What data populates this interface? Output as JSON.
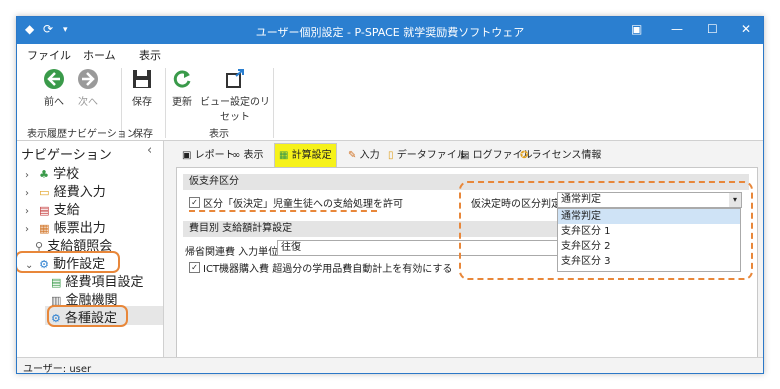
{
  "window": {
    "title": "ユーザー個別設定 - P-SPACE 就学奨励費ソフトウェア"
  },
  "titlebar_icons": {
    "app": "app-icon",
    "refresh": "refresh-icon",
    "dropdown": "chevron-down-icon",
    "minimize": "minimize-icon",
    "maximize": "maximize-icon",
    "close": "close-icon",
    "restore_ribbon": "ribbon-icon"
  },
  "menu": {
    "file": "ファイル",
    "home": "ホーム",
    "view": "表示"
  },
  "ribbon": {
    "back": "前へ",
    "forward": "次へ",
    "save": "保存",
    "update": "更新",
    "reset_view": "ビュー設定のリセット",
    "group_history": "表示履歴ナビゲーション",
    "group_save": "保存",
    "group_view": "表示"
  },
  "nav": {
    "title": "ナビゲーション",
    "collapse": "‹",
    "items": [
      {
        "label": "学校"
      },
      {
        "label": "経費入力"
      },
      {
        "label": "支給"
      },
      {
        "label": "帳票出力"
      },
      {
        "label": "支給額照会"
      },
      {
        "label": "動作設定"
      },
      {
        "label": "経費項目設定"
      },
      {
        "label": "金融機関"
      },
      {
        "label": "各種設定"
      }
    ]
  },
  "tabs": [
    {
      "label": "レポート"
    },
    {
      "label": "表示"
    },
    {
      "label": "計算設定"
    },
    {
      "label": "入力"
    },
    {
      "label": "データファイル"
    },
    {
      "label": "ログファイル"
    },
    {
      "label": "ライセンス情報"
    }
  ],
  "section1": {
    "title": "仮支弁区分",
    "checkbox_label": "区分「仮決定」児童生徒への支給処理を許可",
    "checked": true,
    "select_label": "仮決定時の区分判定",
    "select_value": "通常判定",
    "options": [
      "通常判定",
      "支弁区分 1",
      "支弁区分 2",
      "支弁区分 3"
    ]
  },
  "section2": {
    "title": "費目別 支給額計算設定",
    "unit_label": "帰省関連費 入力単位",
    "unit_value": "往復",
    "ict_label": "ICT機器購入費 超過分の学用品費自動計上を有効にする",
    "ict_checked": true
  },
  "status": {
    "user": "ユーザー: user"
  },
  "colors": {
    "accent": "#2b7fd0",
    "highlight_yellow": "#f6f21a",
    "annotation_orange": "#e8873a",
    "back_green": "#3a9a4a"
  }
}
